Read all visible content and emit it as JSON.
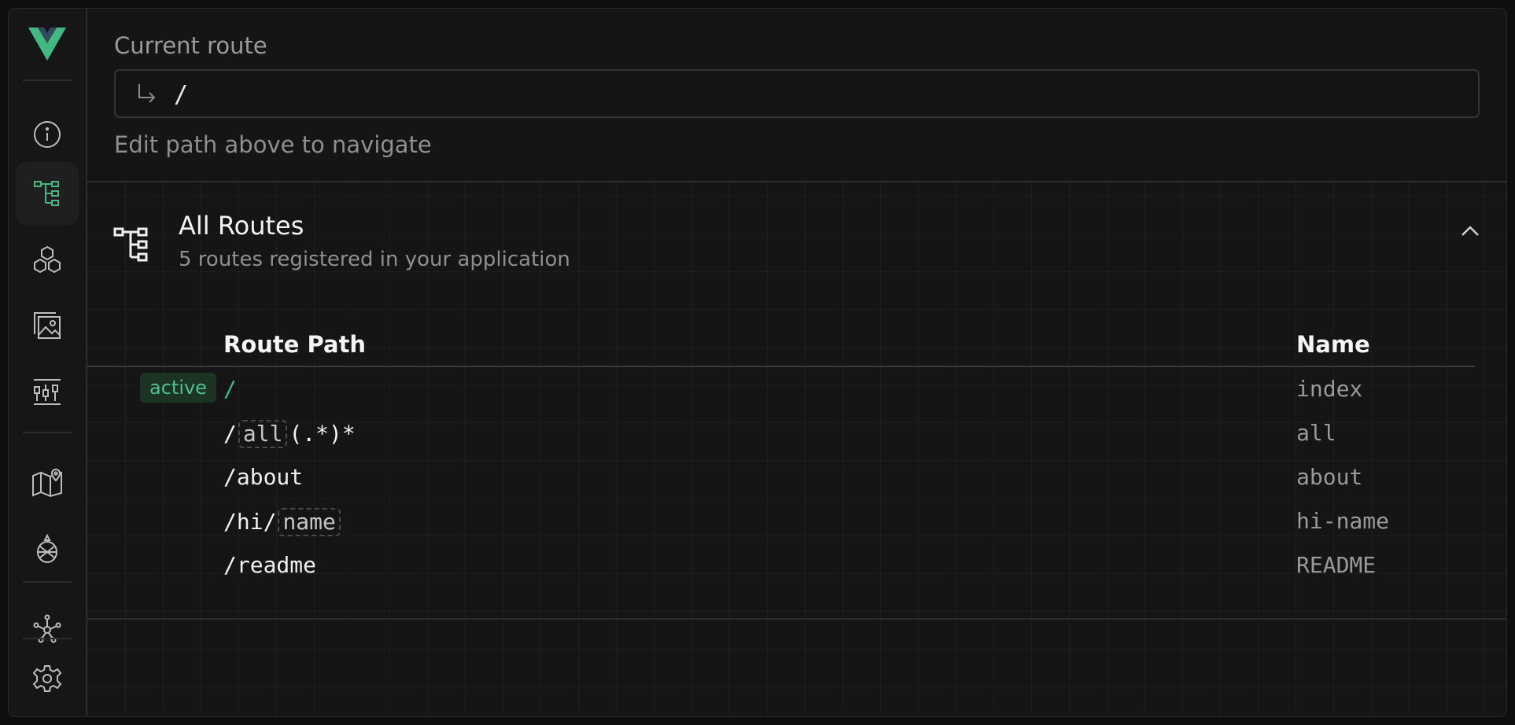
{
  "sidebar": {
    "items": [
      {
        "name": "info"
      },
      {
        "name": "routes",
        "active": true
      },
      {
        "name": "components"
      },
      {
        "name": "assets"
      },
      {
        "name": "timeline"
      },
      {
        "name": "router-map"
      },
      {
        "name": "pinia"
      },
      {
        "name": "graph"
      },
      {
        "name": "settings"
      }
    ]
  },
  "current_route": {
    "label": "Current route",
    "value": "/",
    "hint": "Edit path above to navigate"
  },
  "all_routes": {
    "title": "All Routes",
    "subtitle": "5 routes registered in your application",
    "columns": {
      "path": "Route Path",
      "name": "Name"
    },
    "active_badge": "active",
    "rows": [
      {
        "path_parts": [
          "/"
        ],
        "name": "index",
        "active": true
      },
      {
        "path_parts": [
          "/",
          "all",
          "(.*)*"
        ],
        "name": "all"
      },
      {
        "path_parts": [
          "/about"
        ],
        "name": "about"
      },
      {
        "path_parts": [
          "/hi/",
          "name"
        ],
        "name": "hi-name"
      },
      {
        "path_parts": [
          "/readme"
        ],
        "name": "README"
      }
    ]
  },
  "colors": {
    "accent": "#42b883",
    "background": "#151515",
    "muted_text": "#8f8f8f"
  }
}
